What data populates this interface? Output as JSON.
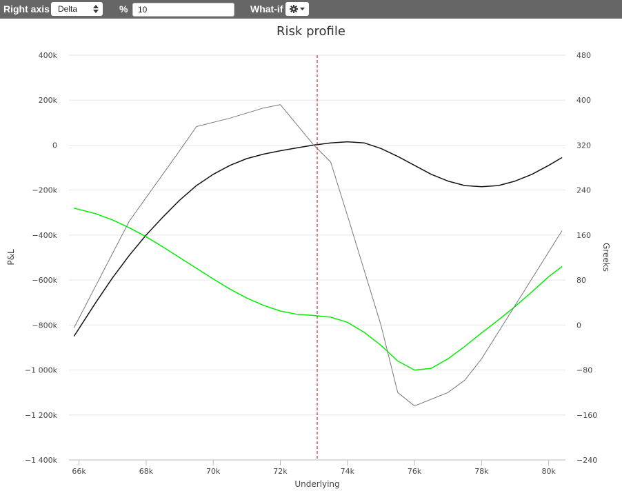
{
  "toolbar": {
    "right_axis_label": "Right axis",
    "right_axis_value": "Delta",
    "percent_label": "%",
    "percent_value": "10",
    "whatif_label": "What-if",
    "whatif_icon": "gear-icon"
  },
  "chart_data": {
    "type": "line",
    "title": "Risk profile",
    "xlabel": "Underlying",
    "ylabel": "P&L",
    "y2label": "Greeks",
    "xlim": [
      65700,
      80500
    ],
    "ylim": [
      -1400000,
      400000
    ],
    "y2lim": [
      -240,
      480
    ],
    "x_ticks": [
      66000,
      68000,
      70000,
      72000,
      74000,
      76000,
      78000,
      80000
    ],
    "x_tick_labels": [
      "66k",
      "68k",
      "70k",
      "72k",
      "74k",
      "76k",
      "78k",
      "80k"
    ],
    "y_ticks": [
      400000,
      200000,
      0,
      -200000,
      -400000,
      -600000,
      -800000,
      -1000000,
      -1200000,
      -1400000
    ],
    "y_tick_labels": [
      "400k",
      "200k",
      "0",
      "−200k",
      "−400k",
      "−600k",
      "−800k",
      "−1 000k",
      "−1 200k",
      "−1 400k"
    ],
    "y2_ticks": [
      480,
      400,
      320,
      240,
      160,
      80,
      0,
      -80,
      -160,
      -240
    ],
    "y2_tick_labels": [
      "480",
      "400",
      "320",
      "240",
      "160",
      "80",
      "0",
      "−80",
      "−160",
      "−240"
    ],
    "grid": true,
    "current_underlying": 73100,
    "series": [
      {
        "axis": "left",
        "color": "#111111",
        "x": [
          65850,
          66500,
          67000,
          67500,
          68000,
          68500,
          69000,
          69500,
          70000,
          70500,
          71000,
          71500,
          72000,
          72500,
          73000,
          73500,
          74000,
          74500,
          75000,
          75500,
          76000,
          76500,
          77000,
          77500,
          78000,
          78500,
          79000,
          79500,
          80000,
          80400
        ],
        "values": [
          -850000,
          -700000,
          -590000,
          -490000,
          -400000,
          -320000,
          -245000,
          -180000,
          -130000,
          -90000,
          -60000,
          -40000,
          -25000,
          -12000,
          0,
          10000,
          15000,
          10000,
          -15000,
          -50000,
          -90000,
          -130000,
          -160000,
          -180000,
          -185000,
          -180000,
          -160000,
          -130000,
          -90000,
          -55000
        ]
      },
      {
        "axis": "right",
        "color": "#00ee00",
        "x": [
          65850,
          66500,
          67000,
          67500,
          68000,
          68500,
          69000,
          69500,
          70000,
          70500,
          71000,
          71500,
          72000,
          72500,
          73000,
          73500,
          74000,
          74500,
          75000,
          75500,
          76000,
          76500,
          77000,
          77500,
          78000,
          78500,
          79000,
          79500,
          80000,
          80400
        ],
        "values": [
          208,
          198,
          187,
          173,
          157,
          139,
          120,
          101,
          82,
          64,
          48,
          35,
          25,
          19,
          17,
          14,
          5,
          -13,
          -36,
          -64,
          -80,
          -77,
          -60,
          -38,
          -14,
          9,
          33,
          59,
          86,
          104
        ]
      },
      {
        "axis": "right",
        "color": "#777777",
        "x": [
          65850,
          66500,
          67500,
          69000,
          69500,
          70500,
          71500,
          72000,
          73000,
          73500,
          74000,
          75000,
          75500,
          76000,
          77000,
          77500,
          78000,
          80400
        ],
        "values": [
          -5,
          70,
          185,
          310,
          353,
          368,
          386,
          392,
          320,
          290,
          195,
          0,
          -120,
          -144,
          -120,
          -98,
          -60,
          168
        ]
      }
    ]
  }
}
